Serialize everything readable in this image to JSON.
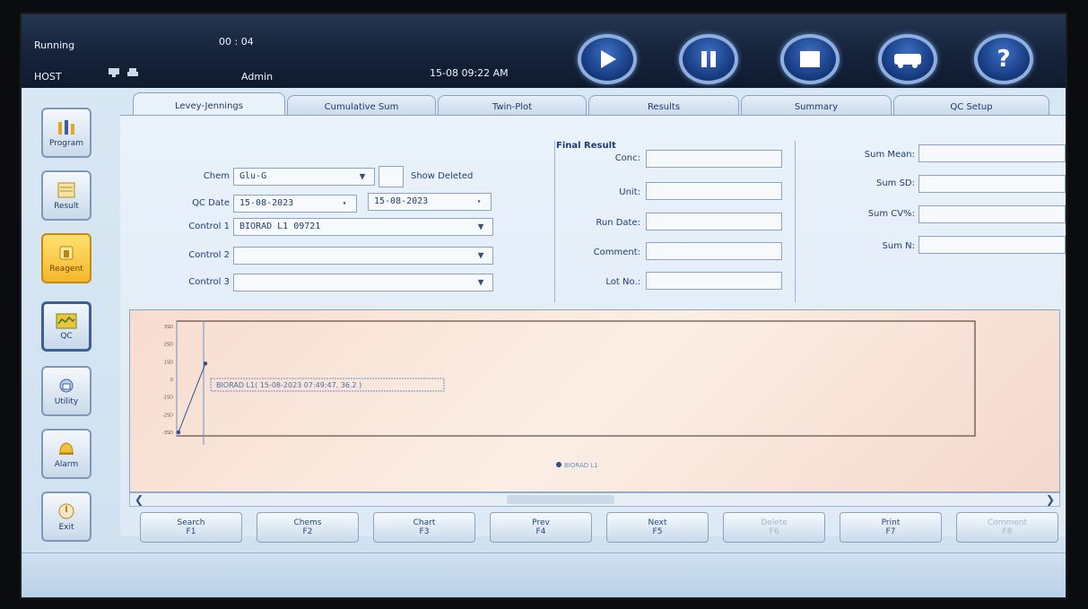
{
  "status": {
    "state": "Running",
    "timer": "00 : 04",
    "host": "HOST",
    "user": "Admin",
    "datetime": "15-08 09:22 AM"
  },
  "toolbar": {
    "buttons": [
      "play-icon",
      "pause-icon",
      "stop-icon",
      "truck-icon",
      "help-icon"
    ],
    "help_label": "?"
  },
  "sidebar": {
    "items": [
      {
        "label": "Program",
        "icon": "program-icon"
      },
      {
        "label": "Result",
        "icon": "result-icon"
      },
      {
        "label": "Reagent",
        "icon": "reagent-icon"
      },
      {
        "label": "QC",
        "icon": "qc-icon"
      },
      {
        "label": "Utility",
        "icon": "utility-icon"
      },
      {
        "label": "Alarm",
        "icon": "alarm-icon"
      },
      {
        "label": "Exit",
        "icon": "exit-icon"
      }
    ]
  },
  "tabs": [
    {
      "label": "Levey-Jennings"
    },
    {
      "label": "Cumulative Sum"
    },
    {
      "label": "Twin-Plot"
    },
    {
      "label": "Results"
    },
    {
      "label": "Summary"
    },
    {
      "label": "QC Setup"
    }
  ],
  "filters": {
    "chem_label": "Chem",
    "chem_value": "Glu-G",
    "show_deleted_label": "Show Deleted",
    "qc_date_label": "QC Date",
    "qc_date_from": "15-08-2023",
    "qc_date_to": "15-08-2023",
    "control1_label": "Control 1",
    "control1_value": "BIORAD L1 09721",
    "control2_label": "Control 2",
    "control2_value": "",
    "control3_label": "Control 3",
    "control3_value": ""
  },
  "final_result": {
    "title": "Final Result",
    "conc_label": "Conc:",
    "unit_label": "Unit:",
    "run_date_label": "Run Date:",
    "comment_label": "Comment:",
    "lot_label": "Lot No.:"
  },
  "summary_fields": {
    "mean_label": "Sum Mean:",
    "sd_label": "Sum SD:",
    "cv_label": "Sum CV%:",
    "n_label": "Sum N:"
  },
  "chart": {
    "tooltip": "BIORAD L1( 15-08-2023 07:49:47, 36.2 )",
    "legend": "BIORAD L1"
  },
  "chart_data": {
    "type": "line",
    "title": "",
    "xlabel": "",
    "ylabel": "",
    "yticks": [
      "3SD",
      "2SD",
      "1SD",
      "0",
      "-1SD",
      "-2SD",
      "-3SD"
    ],
    "series": [
      {
        "name": "BIORAD L1",
        "points": [
          [
            0,
            -3
          ],
          [
            1,
            0.9
          ]
        ],
        "color": "#2d4f86"
      }
    ],
    "ylim": [
      -3,
      3
    ],
    "grid": false
  },
  "function_keys": [
    {
      "label": "Search",
      "key": "F1",
      "enabled": true
    },
    {
      "label": "Chems",
      "key": "F2",
      "enabled": true
    },
    {
      "label": "Chart",
      "key": "F3",
      "enabled": true
    },
    {
      "label": "Prev",
      "key": "F4",
      "enabled": true
    },
    {
      "label": "Next",
      "key": "F5",
      "enabled": true
    },
    {
      "label": "Delete",
      "key": "F6",
      "enabled": false
    },
    {
      "label": "Print",
      "key": "F7",
      "enabled": true
    },
    {
      "label": "Comment",
      "key": "F8",
      "enabled": false
    }
  ],
  "colors": {
    "accent": "#2d4f86",
    "active_sidebar": "#f3b82c",
    "chart_bg": "#f7ddcf"
  }
}
